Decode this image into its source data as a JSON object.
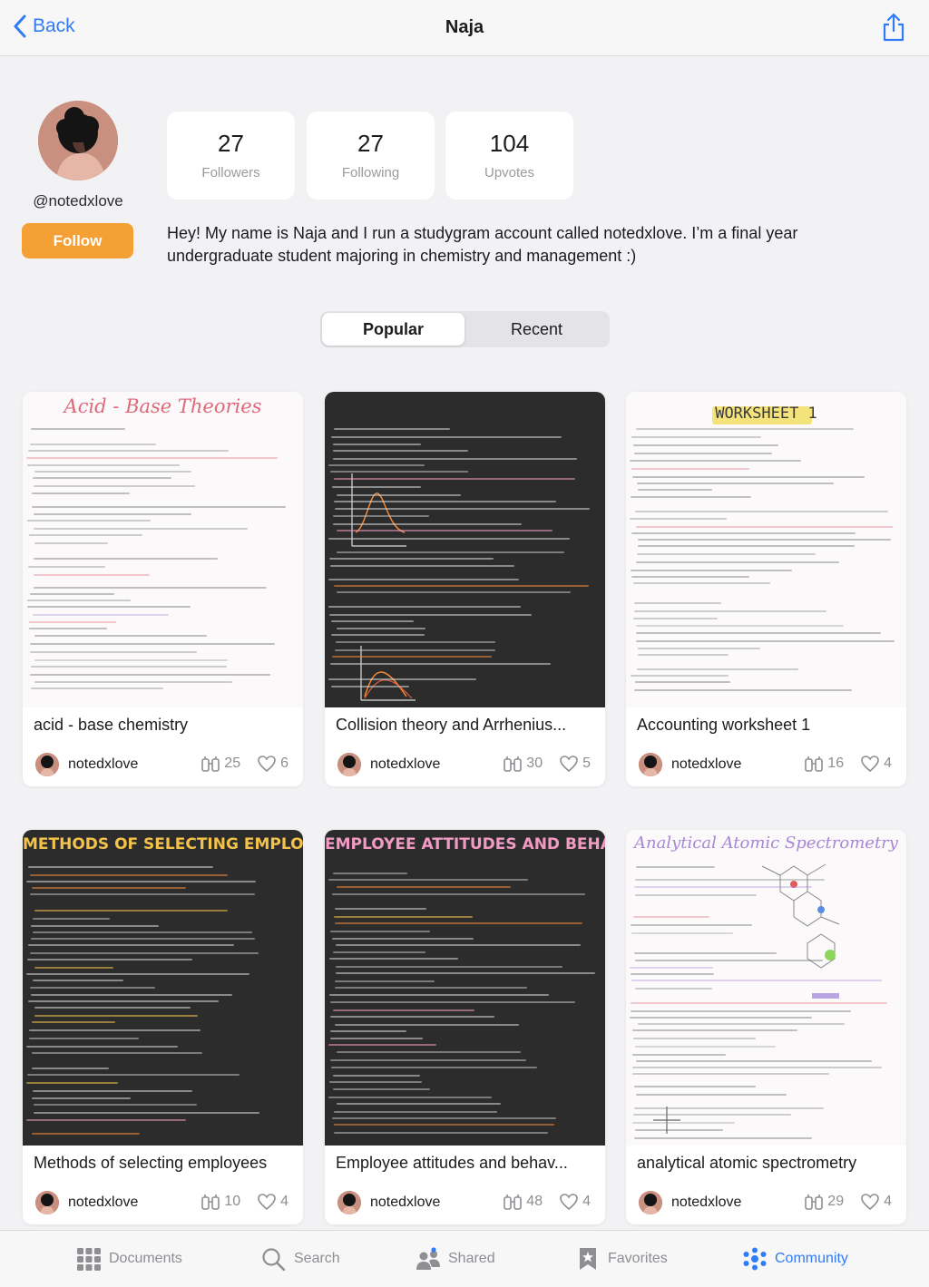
{
  "nav": {
    "back_label": "Back",
    "title": "Naja"
  },
  "profile": {
    "handle": "@notedxlove",
    "follow_label": "Follow",
    "bio": "Hey! My name is Naja and I run a studygram account called notedxlove. I’m a final year undergraduate student majoring in chemistry and management :)",
    "stats": [
      {
        "value": "27",
        "label": "Followers"
      },
      {
        "value": "27",
        "label": "Following"
      },
      {
        "value": "104",
        "label": "Upvotes"
      }
    ]
  },
  "tabs_segment": {
    "popular": "Popular",
    "recent": "Recent",
    "selected": "Popular"
  },
  "cards": [
    {
      "title": "acid - base chemistry",
      "author": "notedxlove",
      "views": "25",
      "likes": "6",
      "heading": "Acid - Base Theories",
      "theme": "light",
      "heading_color": "#e0697a"
    },
    {
      "title": "Collision theory and Arrhenius...",
      "author": "notedxlove",
      "views": "30",
      "likes": "5",
      "heading": "",
      "theme": "dark",
      "heading_color": "#f08a3a"
    },
    {
      "title": "Accounting worksheet 1",
      "author": "notedxlove",
      "views": "16",
      "likes": "4",
      "heading": "WORKSHEET 1",
      "theme": "light",
      "heading_color": "#3a3a3a"
    },
    {
      "title": "Methods of selecting employees",
      "author": "notedxlove",
      "views": "10",
      "likes": "4",
      "heading": "METHODS OF SELECTING EMPLOYEES",
      "theme": "dark",
      "heading_color": "#f3c24a"
    },
    {
      "title": "Employee attitudes and behav...",
      "author": "notedxlove",
      "views": "48",
      "likes": "4",
      "heading": "EMPLOYEE ATTITUDES AND BEHAVIOR",
      "theme": "dark",
      "heading_color": "#f29ac4"
    },
    {
      "title": "analytical atomic spectrometry",
      "author": "notedxlove",
      "views": "29",
      "likes": "4",
      "heading": "Analytical Atomic Spectrometry",
      "theme": "light",
      "heading_color": "#a887d6"
    }
  ],
  "tabbar": {
    "items": [
      {
        "label": "Documents",
        "icon": "grid-icon"
      },
      {
        "label": "Search",
        "icon": "search-icon"
      },
      {
        "label": "Shared",
        "icon": "people-icon"
      },
      {
        "label": "Favorites",
        "icon": "bookmark-star-icon"
      },
      {
        "label": "Community",
        "icon": "community-icon"
      }
    ],
    "active": "Community"
  },
  "colors": {
    "accent": "#2f7cf6",
    "follow": "#f5a035",
    "background": "#f2f2f4"
  }
}
